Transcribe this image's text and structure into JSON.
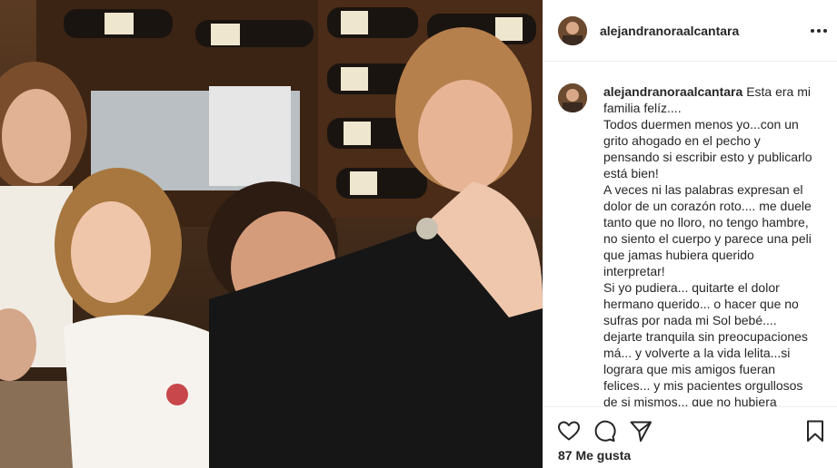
{
  "post": {
    "username": "alejandranoraalcantara",
    "caption_lines": [
      "Esta era mi",
      "familia felíz....",
      "Todos duermen menos yo...con un",
      "grito ahogado en el pecho y",
      "pensando si escribir esto y publicarlo",
      "está bien!",
      "A veces ni las palabras expresan el",
      "dolor de un corazón roto.... me duele",
      "tanto que no lloro, no tengo hambre,",
      "no siento el cuerpo y parece una peli",
      "que jamas hubiera querido",
      "interpretar!",
      "Si yo pudiera... quitarte el dolor",
      "hermano querido... o hacer que no",
      "sufras por nada mi Sol bebé....",
      "dejarte tranquila sin preocupaciones",
      "má... y volverte a la vida lelita...si",
      "lograra que mis amigos fueran",
      "felices... y mis pacientes orgullosos",
      "de si mismos... que no hubiera"
    ],
    "likes_label": "87 Me gusta"
  },
  "icons": {
    "header_more": "more-options-icon",
    "like": "heart-icon",
    "comment": "comment-icon",
    "share": "share-icon",
    "save": "bookmark-icon"
  },
  "colors": {
    "text": "#262626",
    "border": "#efefef"
  }
}
